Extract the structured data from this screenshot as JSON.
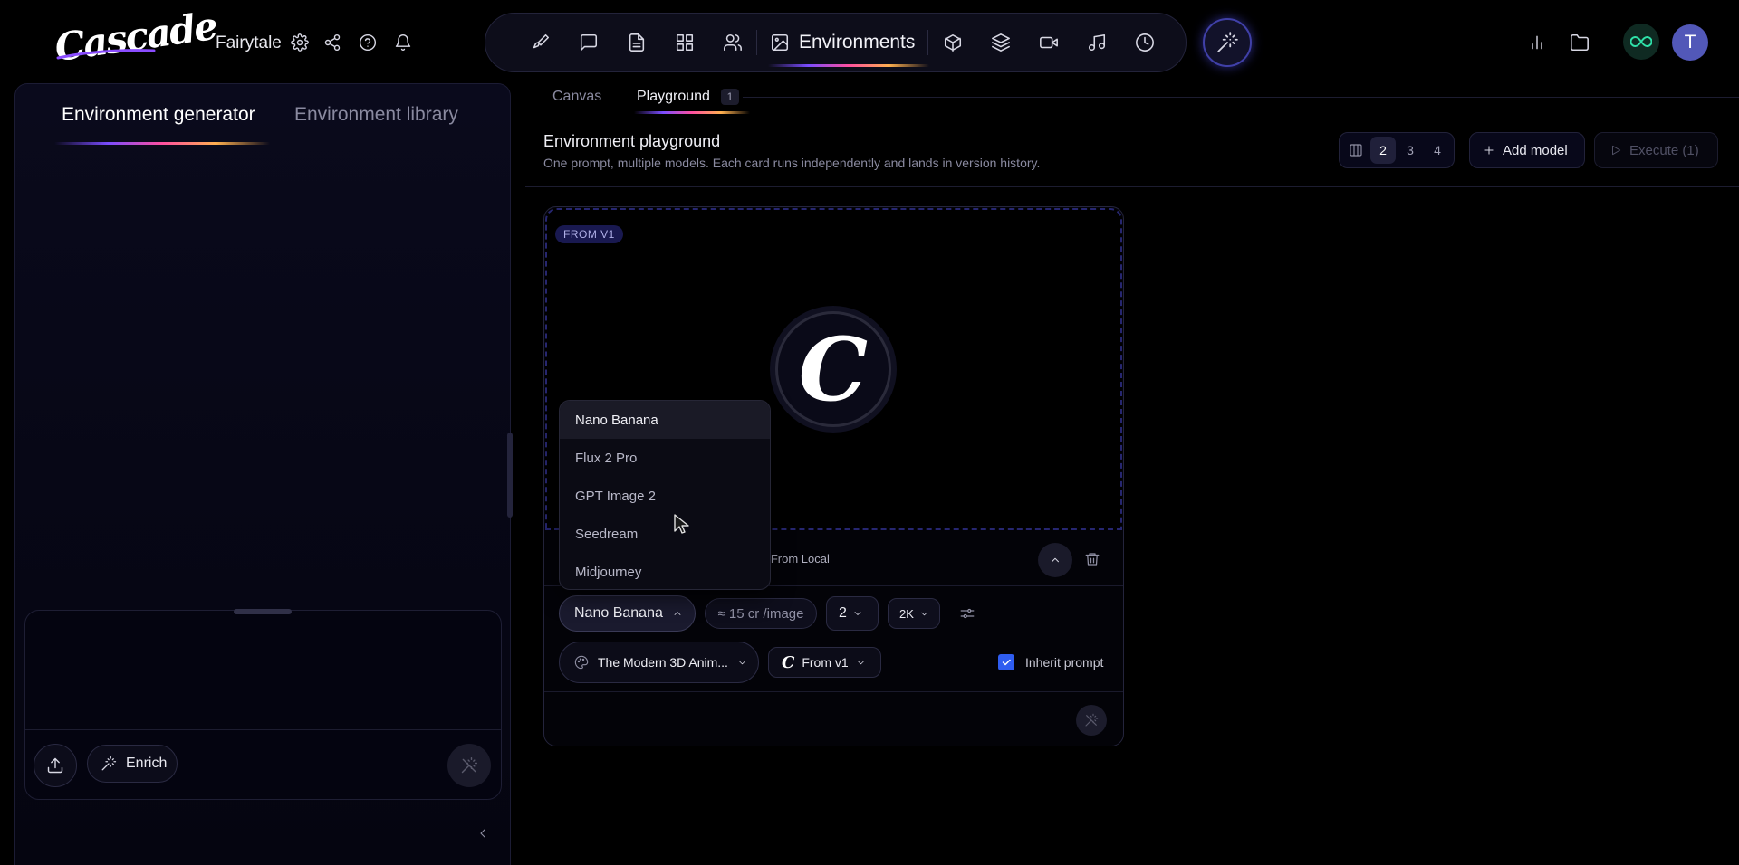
{
  "app": {
    "logo_text": "Cascade",
    "project_name": "Fairytale",
    "avatar_initial": "T"
  },
  "toolbar": {
    "active_label": "Environments",
    "icons": [
      "brush-icon",
      "chat-icon",
      "document-icon",
      "grid-icon",
      "users-icon",
      "image-icon",
      "cube-icon",
      "layers-icon",
      "video-icon",
      "music-icon",
      "clock-icon"
    ]
  },
  "left_panel": {
    "tabs": [
      {
        "label": "Environment generator",
        "active": true
      },
      {
        "label": "Environment library",
        "active": false
      }
    ],
    "enrich_label": "Enrich"
  },
  "subtabs": {
    "canvas": "Canvas",
    "playground": "Playground",
    "playground_count": "1"
  },
  "playground": {
    "title": "Environment playground",
    "subtitle": "One prompt, multiple models. Each card runs independently and lands in version history.",
    "columns": [
      "2",
      "3",
      "4"
    ],
    "selected_columns": "2",
    "add_model_label": "Add model",
    "execute_label": "Execute (1)"
  },
  "card": {
    "badge": "FROM V1",
    "logo_letter": "C",
    "local_text": "d From Local",
    "model": "Nano Banana",
    "cost": "≈ 15 cr  /image",
    "count": "2",
    "resolution": "2K",
    "style": "The Modern 3D Anim...",
    "version": "From v1",
    "inherit_label": "Inherit prompt",
    "inherit_checked": true
  },
  "dropdown": {
    "options": [
      "Nano Banana",
      "Flux 2 Pro",
      "GPT Image 2",
      "Seedream",
      "Midjourney"
    ],
    "selected": "Nano Banana"
  },
  "colors": {
    "accent": "#2f5df0",
    "avatar": "#5258b8",
    "infinity": "#2fe0a8",
    "background": "#000000"
  }
}
